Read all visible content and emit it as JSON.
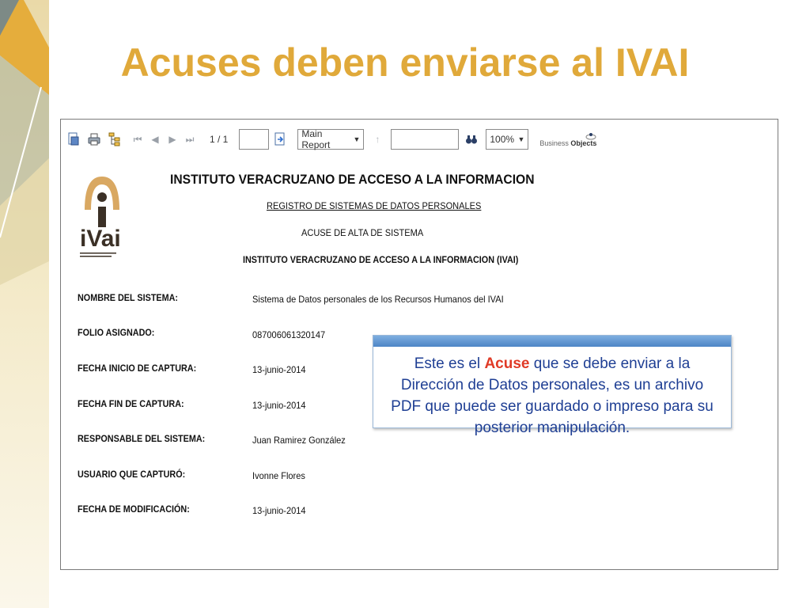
{
  "slide": {
    "title": "Acuses deben enviarse al IVAI"
  },
  "toolbar": {
    "page_indicator": "1 / 1",
    "goto_page_value": "",
    "report_select": "Main Report",
    "search_value": "",
    "zoom_select": "100%",
    "brand_small": "Business",
    "brand_bold": "Objects"
  },
  "report": {
    "heading": "INSTITUTO VERACRUZANO DE ACCESO A LA INFORMACION",
    "subheading": "REGISTRO DE SISTEMAS DE DATOS PERSONALES",
    "doc_type": "ACUSE DE ALTA DE SISTEMA",
    "entity": "INSTITUTO VERACRUZANO DE ACCESO A LA INFORMACION (IVAI)",
    "logo_text": "iVai",
    "fields": [
      {
        "label": "NOMBRE DEL SISTEMA:",
        "value": "Sistema de Datos personales de los Recursos Humanos del IVAI"
      },
      {
        "label": "FOLIO ASIGNADO:",
        "value": "087006061320147"
      },
      {
        "label": "FECHA INICIO DE CAPTURA:",
        "value": "13-junio-2014"
      },
      {
        "label": "FECHA FIN DE CAPTURA:",
        "value": "13-junio-2014"
      },
      {
        "label": "RESPONSABLE DEL SISTEMA:",
        "value": "Juan Ramirez González"
      },
      {
        "label": "USUARIO QUE CAPTURÓ:",
        "value": "Ivonne Flores"
      },
      {
        "label": "FECHA DE MODIFICACIÓN:",
        "value": "13-junio-2014"
      }
    ]
  },
  "callout": {
    "text_before": "Este es el ",
    "highlight": "Acuse",
    "text_after": " que se debe enviar a la Dirección de Datos personales, es un archivo PDF que puede ser guardado o impreso para su posterior manipulación."
  },
  "colors": {
    "title": "#e0a93a",
    "callout_text": "#1f3f94",
    "highlight": "#e03a26",
    "callout_bar": "#4d85c6"
  }
}
